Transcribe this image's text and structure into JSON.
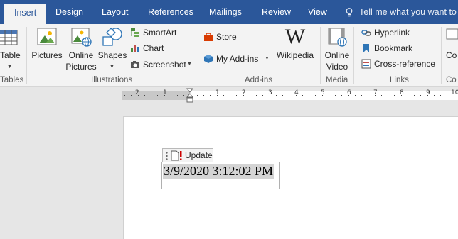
{
  "tabs": [
    {
      "label": "Insert",
      "active": true
    },
    {
      "label": "Design"
    },
    {
      "label": "Layout"
    },
    {
      "label": "References"
    },
    {
      "label": "Mailings"
    },
    {
      "label": "Review"
    },
    {
      "label": "View"
    }
  ],
  "tell_me": "Tell me what you want to d",
  "ribbon": {
    "tables": {
      "table_label": "Table",
      "group": "Tables"
    },
    "illustrations": {
      "pictures": "Pictures",
      "online_pictures_1": "Online",
      "online_pictures_2": "Pictures",
      "shapes": "Shapes",
      "smartart": "SmartArt",
      "chart": "Chart",
      "screenshot": "Screenshot",
      "group": "Illustrations"
    },
    "addins": {
      "store": "Store",
      "my_addins": "My Add-ins",
      "wikipedia": "Wikipedia",
      "group": "Add-ins"
    },
    "media": {
      "online_video_1": "Online",
      "online_video_2": "Video",
      "group": "Media"
    },
    "links": {
      "hyperlink": "Hyperlink",
      "bookmark": "Bookmark",
      "cross_reference": "Cross-reference",
      "group": "Links"
    },
    "comments": {
      "comment": "Co",
      "group": "Co"
    }
  },
  "ruler": {
    "ticks": [
      "2",
      "1",
      "1",
      "2",
      "3",
      "4",
      "5",
      "6",
      "7",
      "8",
      "9",
      "10"
    ]
  },
  "document": {
    "field_update": "Update",
    "field_text": "3/9/2020 3:12:02 PM"
  },
  "colors": {
    "accent": "#2b579a",
    "ribbon_bg": "#f3f3f3",
    "field_shading": "#d4d4d4"
  }
}
